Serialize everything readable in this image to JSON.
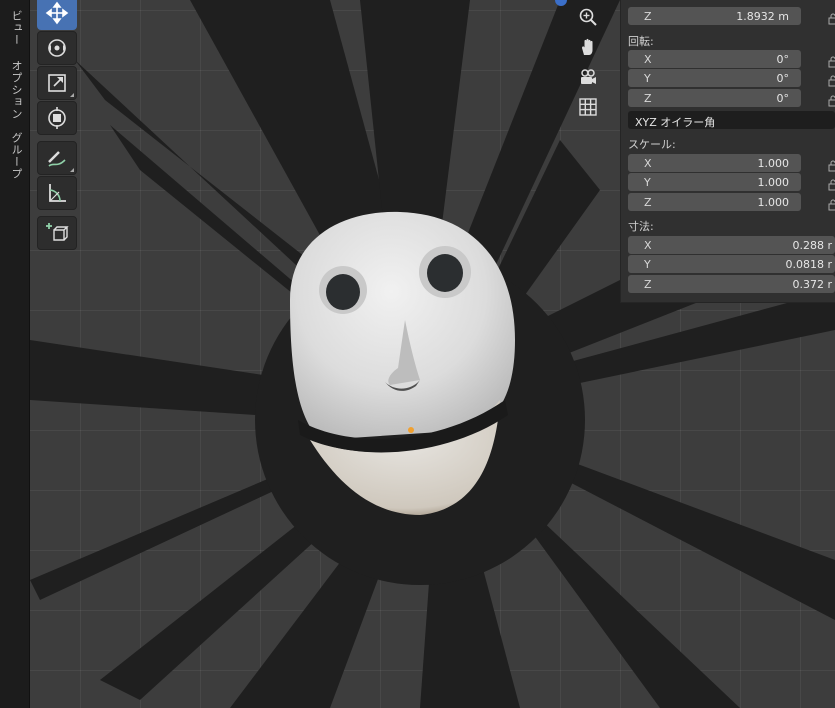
{
  "sidebar_tabs": [
    "ビュー",
    "オプション",
    "グループ"
  ],
  "toolbar": {
    "tools": [
      {
        "name": "move-tool",
        "icon": "move-icon",
        "active": true
      },
      {
        "name": "rotate-tool",
        "icon": "rotate-icon",
        "active": false
      },
      {
        "name": "scale-tool",
        "icon": "scale-icon",
        "active": false
      },
      {
        "name": "transform-tool",
        "icon": "transform-icon",
        "active": false
      },
      {
        "name": "annotate-tool",
        "icon": "annotate-pencil-icon",
        "active": false
      },
      {
        "name": "measure-tool",
        "icon": "measure-ruler-icon",
        "active": false
      },
      {
        "name": "add-cube-tool",
        "icon": "add-cube-icon",
        "active": false
      }
    ]
  },
  "navigation": [
    "zoom-icon",
    "hand-pan-icon",
    "camera-icon",
    "grid-ortho-icon"
  ],
  "transform_panel": {
    "location_z": {
      "axis": "Z",
      "value": "1.8932 m"
    },
    "rotation": {
      "label": "回転:",
      "x": {
        "axis": "X",
        "value": "0°"
      },
      "y": {
        "axis": "Y",
        "value": "0°"
      },
      "z": {
        "axis": "Z",
        "value": "0°"
      },
      "mode": "XYZ オイラー角"
    },
    "scale": {
      "label": "スケール:",
      "x": {
        "axis": "X",
        "value": "1.000"
      },
      "y": {
        "axis": "Y",
        "value": "1.000"
      },
      "z": {
        "axis": "Z",
        "value": "1.000"
      }
    },
    "dimensions": {
      "label": "寸法:",
      "x": {
        "axis": "X",
        "value": "0.288 r"
      },
      "y": {
        "axis": "Y",
        "value": "0.0818 r"
      },
      "z": {
        "axis": "Z",
        "value": "0.372 r"
      }
    }
  },
  "colors": {
    "accent": "#4772b3",
    "panel_bg": "#303030",
    "field_bg": "#545454",
    "viewport_bg": "#3d3d3d",
    "spikes": "#1f1f1f",
    "face": "#e6e6e6",
    "origin": "#f0a030"
  }
}
